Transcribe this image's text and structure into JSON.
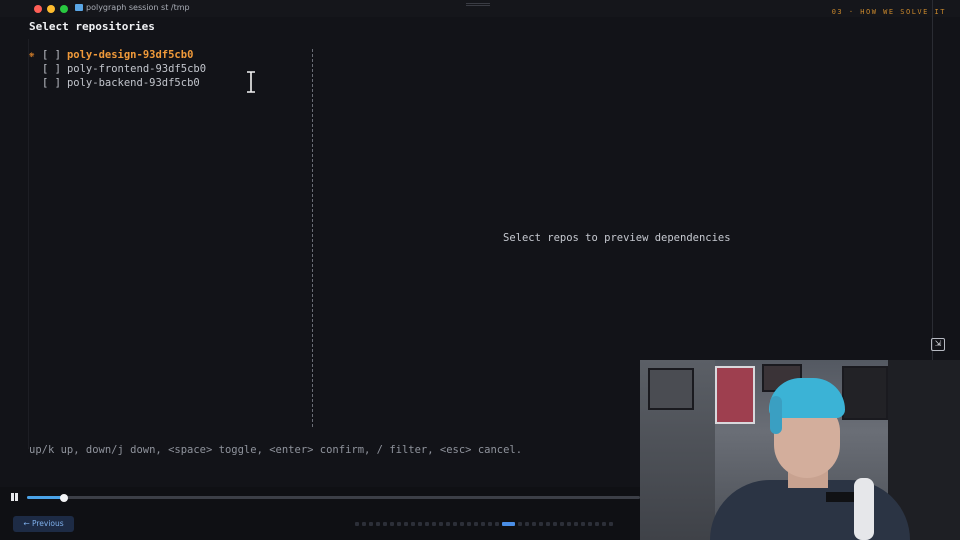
{
  "window": {
    "title": "polygraph session st /tmp",
    "slide_tag": "03 · HOW WE SOLVE IT"
  },
  "terminal": {
    "heading": "Select repositories",
    "cursor_marker": "❋",
    "checkbox": "[ ]",
    "repos": [
      {
        "name": "poly-design-93df5cb0",
        "checked": false,
        "active": true
      },
      {
        "name": "poly-frontend-93df5cb0",
        "checked": false,
        "active": false
      },
      {
        "name": "poly-backend-93df5cb0",
        "checked": false,
        "active": false
      }
    ],
    "preview_text": "Select repos to preview dependencies",
    "help_text": "up/k up, down/j down, <space> toggle, <enter> confirm, / filter, <esc> cancel."
  },
  "player": {
    "progress": 0.06,
    "prev_label": "← Previous",
    "slide_count": 36,
    "current_slide_index": 21
  },
  "icons": {
    "pip": "picture-in-picture-exit-icon",
    "pause": "pause-icon",
    "folder": "folder-icon"
  },
  "colors": {
    "accent_orange": "#f09a3a",
    "progress_blue": "#4aa3e8",
    "background": "#121318"
  }
}
